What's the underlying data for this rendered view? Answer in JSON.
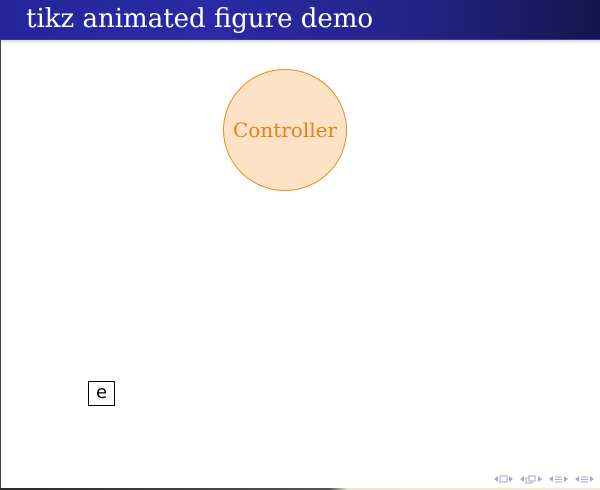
{
  "frame": {
    "title": "tikz animated figure demo",
    "title_bar_color": "#25259a",
    "title_text_color": "#ffffff"
  },
  "figure": {
    "controller_label": "Controller",
    "controller_fill": "#fde2c6",
    "controller_stroke": "#f08a1c",
    "controller_text_color": "#e5801a",
    "error_label": "e"
  },
  "navigation": {
    "icons": [
      "prev-slide-icon",
      "slide-icon",
      "next-slide-icon",
      "prev-frame-icon",
      "frame-icon",
      "next-frame-icon",
      "prev-subsection-icon",
      "subsection-icon",
      "next-subsection-icon",
      "prev-section-icon",
      "section-icon",
      "next-section-icon"
    ],
    "color": "#a8a8d0"
  }
}
